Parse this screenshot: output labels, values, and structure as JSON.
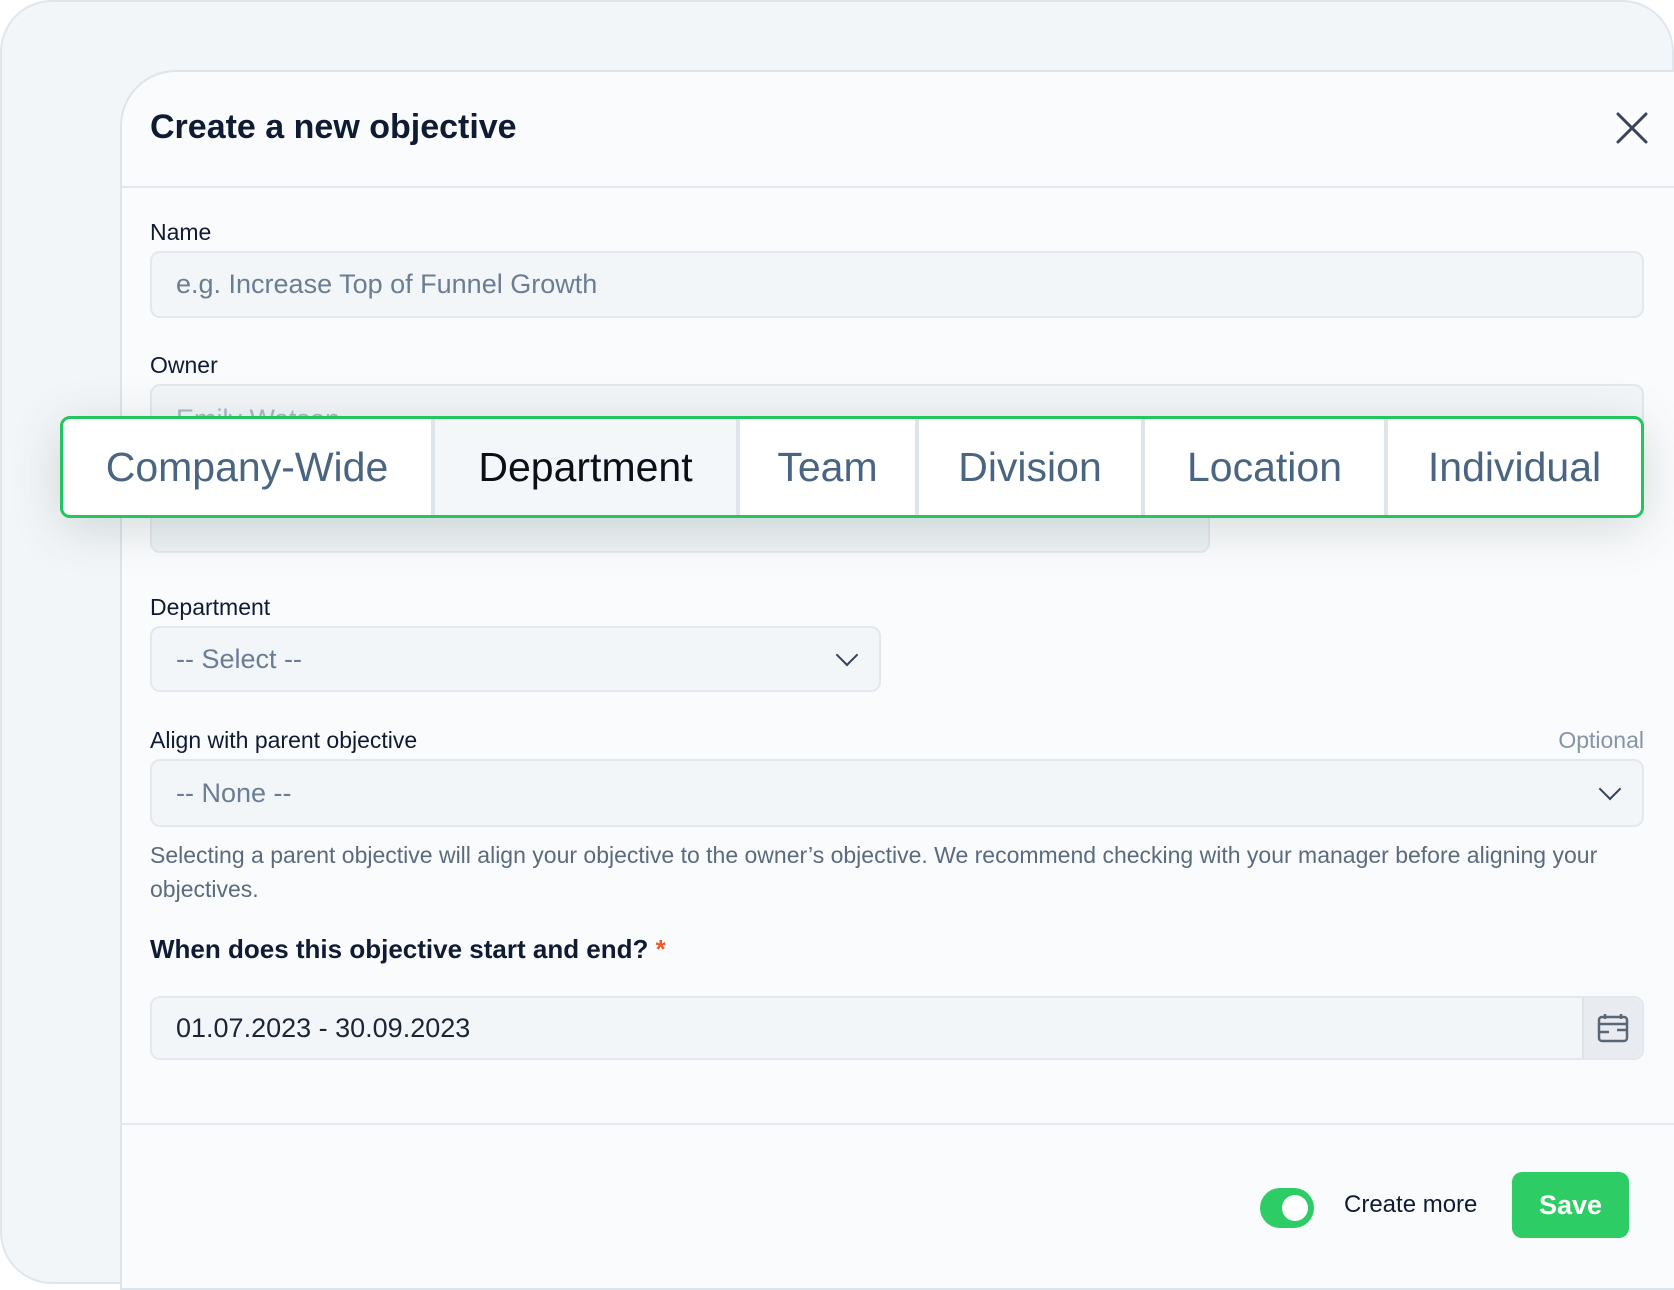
{
  "modal": {
    "title": "Create a new objective",
    "close_icon": "close-icon"
  },
  "name": {
    "label": "Name",
    "placeholder": "e.g. Increase Top of Funnel Growth"
  },
  "owner": {
    "label": "Owner",
    "value": "Emily Watson"
  },
  "scope_tabs": {
    "items": [
      "Company-Wide",
      "Department",
      "Team",
      "Division",
      "Location",
      "Individual"
    ],
    "selected": "Department",
    "highlight_color": "#22c55e"
  },
  "department": {
    "label": "Department",
    "value": "-- Select --"
  },
  "parent": {
    "label": "Align with parent objective",
    "optional": "Optional",
    "value": "-- None --",
    "help": "Selecting a parent objective will align your objective to the owner’s objective. We recommend checking with your manager before aligning your objectives."
  },
  "dates": {
    "question": "When does this objective start and end?",
    "required_mark": "*",
    "value": "01.07.2023 - 30.09.2023",
    "icon": "calendar-icon"
  },
  "footer": {
    "create_more_label": "Create more",
    "create_more_on": true,
    "save_label": "Save",
    "accent": "#2ecc64"
  }
}
